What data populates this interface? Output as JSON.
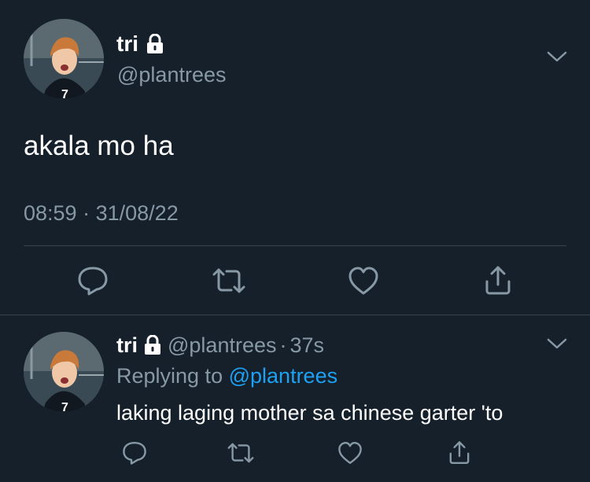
{
  "main_tweet": {
    "author_name": "tri",
    "handle": "@plantrees",
    "text": "akala mo ha",
    "time": "08:59",
    "separator": "·",
    "date": "31/08/22",
    "protected_icon": "lock-icon",
    "actions": [
      "reply-icon",
      "retweet-icon",
      "like-icon",
      "share-icon"
    ]
  },
  "reply_tweet": {
    "author_name": "tri",
    "handle": "@plantrees",
    "separator": "·",
    "time_ago": "37s",
    "replying_prefix": "Replying to",
    "replying_to": "@plantrees",
    "text": "laking laging mother sa chinese garter 'to",
    "protected_icon": "lock-icon",
    "actions": [
      "reply-icon",
      "retweet-icon",
      "like-icon",
      "share-icon"
    ]
  },
  "colors": {
    "background": "#15202b",
    "primary_text": "#ffffff",
    "secondary_text": "#8899a6",
    "link": "#1da1f2",
    "divider": "#38444d"
  }
}
